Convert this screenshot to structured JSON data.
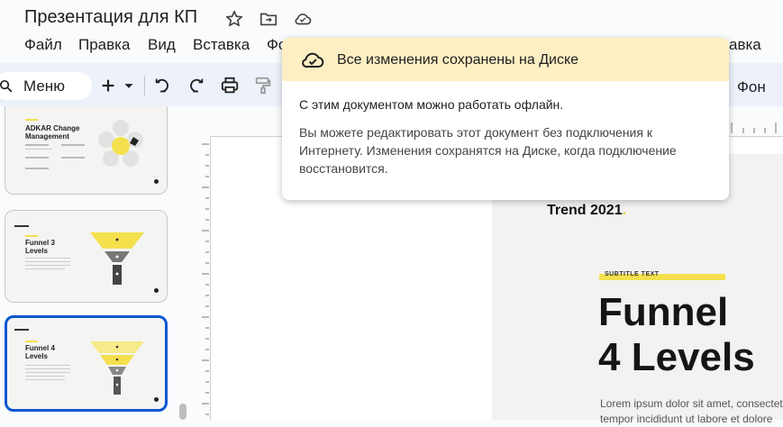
{
  "document": {
    "title": "Презентация для КП"
  },
  "menubar": {
    "items": [
      "Файл",
      "Правка",
      "Вид",
      "Вставка",
      "Фо",
      "авка"
    ]
  },
  "toolbar": {
    "menu_search_label": "Меню",
    "background_label": "Фон"
  },
  "popup": {
    "header": "Все изменения сохранены на Диске",
    "line1": "С этим документом можно работать офлайн.",
    "body": "Вы можете редактировать этот документ без подключения к Интернету. Изменения сохранятся на Диске, когда подключение восстановится."
  },
  "slides": [
    {
      "title": "ADKAR Change Management"
    },
    {
      "title": "Funnel 3 Levels"
    },
    {
      "title": "Funnel 4 Levels",
      "selected": true
    }
  ],
  "canvas": {
    "trend": "Trend 2021",
    "subtitle": "SUBTITLE TEXT",
    "title_line1": "Funnel",
    "title_line2": "4 Levels",
    "lorem_line1": "Lorem ipsum dolor sit amet, consectetu",
    "lorem_line2": "tempor incididunt ut labore et dolore"
  },
  "colors": {
    "accent_yellow": "#f4e04d",
    "selection_blue": "#0b57d0",
    "popup_header": "#fdefc3"
  }
}
